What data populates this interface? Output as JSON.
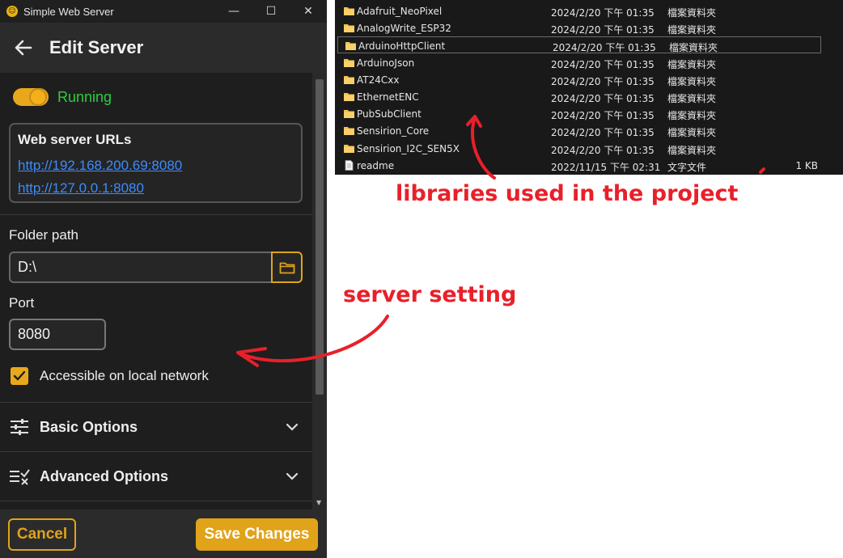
{
  "window": {
    "title": "Simple Web Server",
    "logo_glyph": "☺",
    "minimize_glyph": "—",
    "maximize_glyph": "☐",
    "close_glyph": "✕"
  },
  "header": {
    "title": "Edit Server",
    "back_icon": "arrow-left-icon"
  },
  "status": {
    "label": "Running",
    "running": true
  },
  "urls": {
    "title": "Web server URLs",
    "items": [
      "http://192.168.200.69:8080",
      "http://127.0.0.1:8080"
    ]
  },
  "folder": {
    "label": "Folder path",
    "value": "D:\\",
    "browse_icon": "folder-icon"
  },
  "port": {
    "label": "Port",
    "value": "8080"
  },
  "network": {
    "label": "Accessible on local network",
    "checked": true
  },
  "sections": [
    {
      "label": "Basic Options",
      "icon": "sliders-icon"
    },
    {
      "label": "Advanced Options",
      "icon": "list-check-icon"
    }
  ],
  "footer": {
    "cancel_label": "Cancel",
    "save_label": "Save Changes"
  },
  "files": [
    {
      "name": "Adafruit_NeoPixel",
      "date": "2024/2/20 下午 01:35",
      "type": "檔案資料夾",
      "size": "",
      "kind": "folder"
    },
    {
      "name": "AnalogWrite_ESP32",
      "date": "2024/2/20 下午 01:35",
      "type": "檔案資料夾",
      "size": "",
      "kind": "folder"
    },
    {
      "name": "ArduinoHttpClient",
      "date": "2024/2/20 下午 01:35",
      "type": "檔案資料夾",
      "size": "",
      "kind": "folder"
    },
    {
      "name": "ArduinoJson",
      "date": "2024/2/20 下午 01:35",
      "type": "檔案資料夾",
      "size": "",
      "kind": "folder"
    },
    {
      "name": "AT24Cxx",
      "date": "2024/2/20 下午 01:35",
      "type": "檔案資料夾",
      "size": "",
      "kind": "folder"
    },
    {
      "name": "EthernetENC",
      "date": "2024/2/20 下午 01:35",
      "type": "檔案資料夾",
      "size": "",
      "kind": "folder"
    },
    {
      "name": "PubSubClient",
      "date": "2024/2/20 下午 01:35",
      "type": "檔案資料夾",
      "size": "",
      "kind": "folder"
    },
    {
      "name": "Sensirion_Core",
      "date": "2024/2/20 下午 01:35",
      "type": "檔案資料夾",
      "size": "",
      "kind": "folder"
    },
    {
      "name": "Sensirion_I2C_SEN5X",
      "date": "2024/2/20 下午 01:35",
      "type": "檔案資料夾",
      "size": "",
      "kind": "folder"
    },
    {
      "name": "readme",
      "date": "2022/11/15 下午 02:31",
      "type": "文字文件",
      "size": "1 KB",
      "kind": "file"
    }
  ],
  "annotations": {
    "libraries": "libraries used in the project",
    "server": "server setting"
  },
  "colors": {
    "accent": "#e0a31a",
    "running": "#2ecc40",
    "link": "#3d8bfd",
    "annotation": "#e8202a"
  }
}
